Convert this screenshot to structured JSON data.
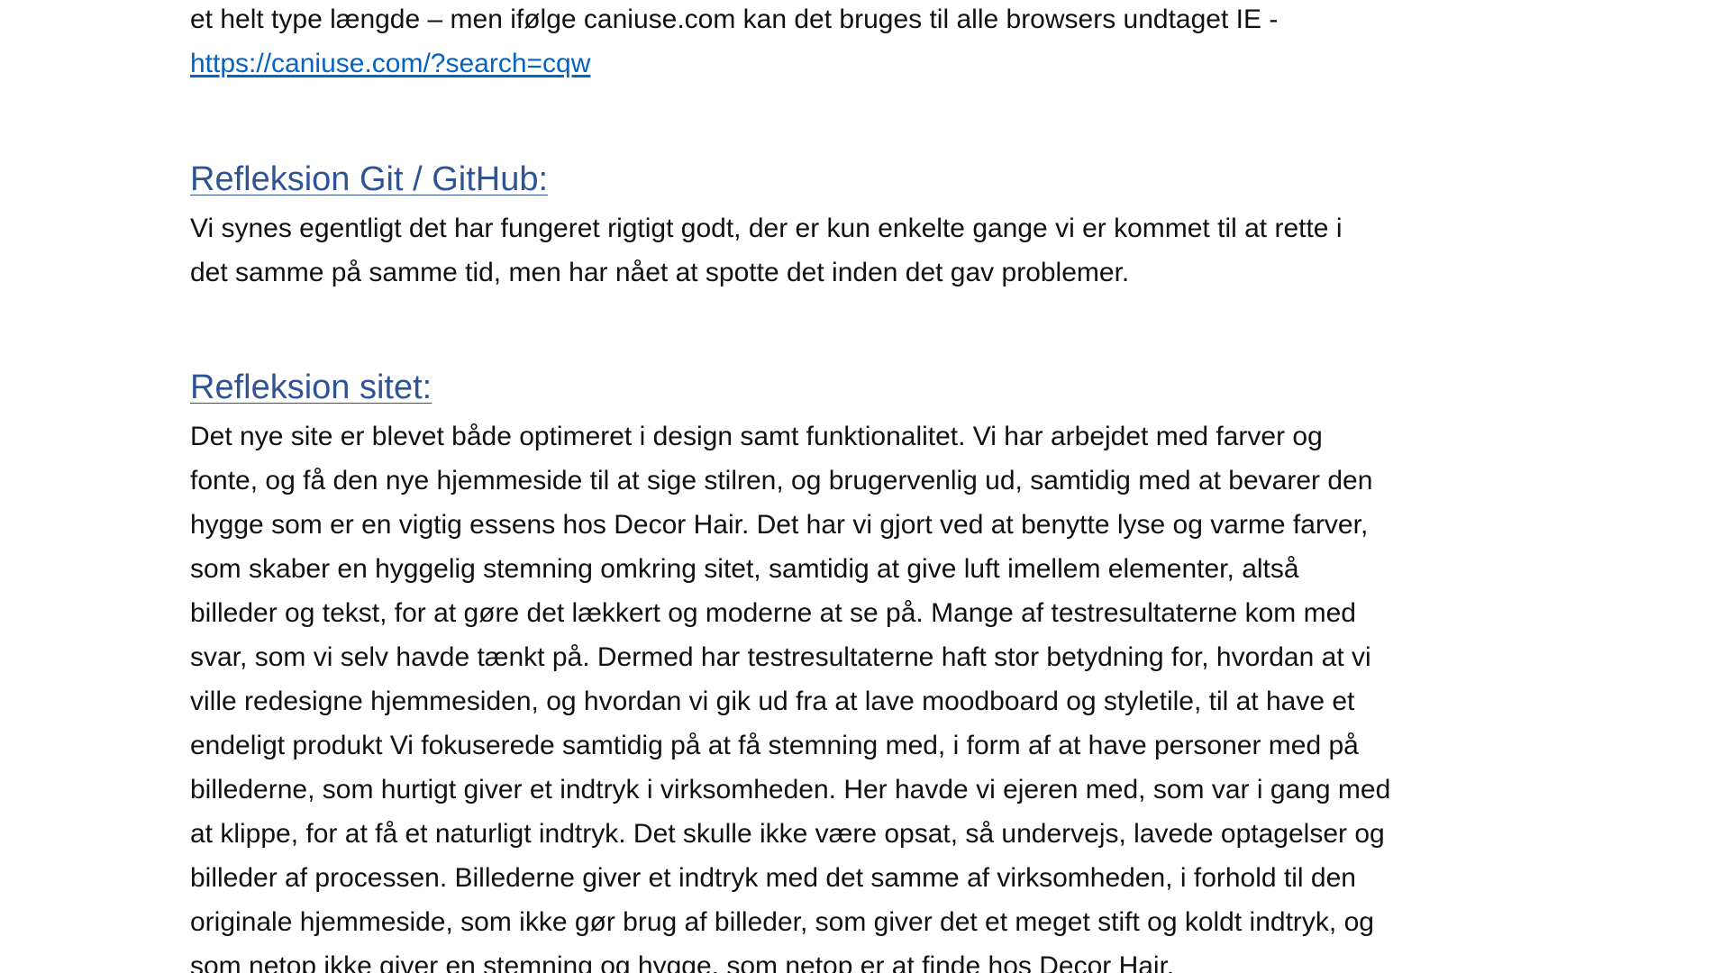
{
  "intro": {
    "line1": "et helt type længde – men ifølge caniuse.com kan det bruges til alle browsers undtaget IE -",
    "link": "https://caniuse.com/?search=cqw"
  },
  "sections": [
    {
      "heading": "Refleksion Git / GitHub:",
      "lines": [
        "Vi synes egentligt det har fungeret rigtigt godt, der er kun enkelte gange vi er kommet til at rette i",
        "det samme på samme tid, men har nået at spotte det inden det gav problemer."
      ]
    },
    {
      "heading": "Refleksion sitet:",
      "lines": [
        "Det nye site er blevet både optimeret i design samt funktionalitet. Vi har arbejdet med farver og",
        "fonte, og få den nye hjemmeside til at sige stilren, og brugervenlig ud, samtidig med at bevarer den",
        "hygge som er en vigtig essens hos Decor Hair. Det har vi gjort ved at benytte lyse og varme farver,",
        "som skaber en hyggelig stemning omkring sitet, samtidig at give luft imellem elementer, altså",
        "billeder og tekst, for at gøre det lækkert og moderne at se på. Mange af testresultaterne kom med",
        "svar, som vi selv havde tænkt på. Dermed har testresultaterne haft stor betydning for, hvordan at vi",
        "ville redesigne hjemmesiden, og hvordan vi gik ud fra at lave moodboard og styletile, til at have et",
        "endeligt produkt Vi fokuserede samtidig på at få stemning med, i form af at have personer med på",
        "billederne, som hurtigt giver et indtryk i virksomheden. Her havde vi ejeren med, som var i gang med",
        "at klippe, for at få et naturligt indtryk. Det skulle ikke være opsat, så undervejs, lavede optagelser og",
        "billeder af processen. Billederne giver et indtryk med det samme af virksomheden, i forhold til den",
        "originale hjemmeside, som ikke gør brug af billeder, som giver det et meget stift og koldt indtryk, og",
        "som netop ikke giver en stemning og hygge, som netop er at finde hos Decor Hair."
      ]
    }
  ],
  "colors": {
    "text": "#111111",
    "link": "#0563c1",
    "heading": "#2f5496"
  }
}
